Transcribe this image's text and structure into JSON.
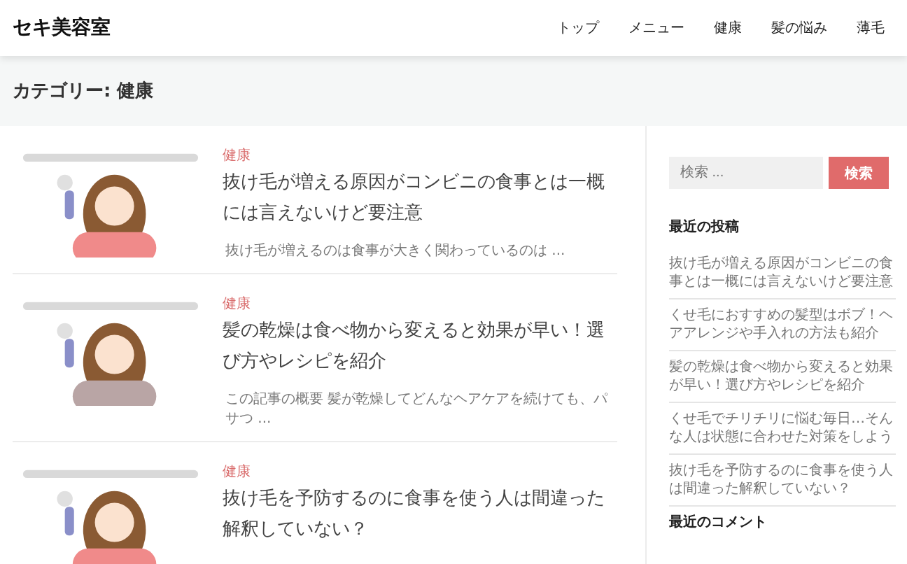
{
  "site": {
    "title": "セキ美容室"
  },
  "nav": [
    {
      "label": "トップ"
    },
    {
      "label": "メニュー"
    },
    {
      "label": "健康"
    },
    {
      "label": "髪の悩み"
    },
    {
      "label": "薄毛"
    }
  ],
  "archive": {
    "title": "カテゴリー: 健康"
  },
  "posts": [
    {
      "category": "健康",
      "title": "抜け毛が増える原因がコンビニの食事とは一概には言えないけど要注意",
      "excerpt": "抜け毛が増えるのは食事が大きく関わっているのは ..."
    },
    {
      "category": "健康",
      "title": "髪の乾燥は食べ物から変えると効果が早い！選び方やレシピを紹介",
      "excerpt": "この記事の概要 髪が乾燥してどんなヘアケアを続けても、パサつ ..."
    },
    {
      "category": "健康",
      "title": "抜け毛を予防するのに食事を使う人は間違った解釈していない？"
    }
  ],
  "sidebar": {
    "search": {
      "placeholder": "検索 ...",
      "button": "検索"
    },
    "recent_posts": {
      "heading": "最近の投稿",
      "items": [
        "抜け毛が増える原因がコンビニの食事とは一概には言えないけど要注意",
        "くせ毛におすすめの髪型はボブ！ヘアアレンジや手入れの方法も紹介",
        "髪の乾燥は食べ物から変えると効果が早い！選び方やレシピを紹介",
        "くせ毛でチリチリに悩む毎日…そんな人は状態に合わせた対策をしよう",
        "抜け毛を予防するのに食事を使う人は間違った解釈していない？"
      ]
    },
    "recent_comments": {
      "heading": "最近のコメント"
    }
  }
}
